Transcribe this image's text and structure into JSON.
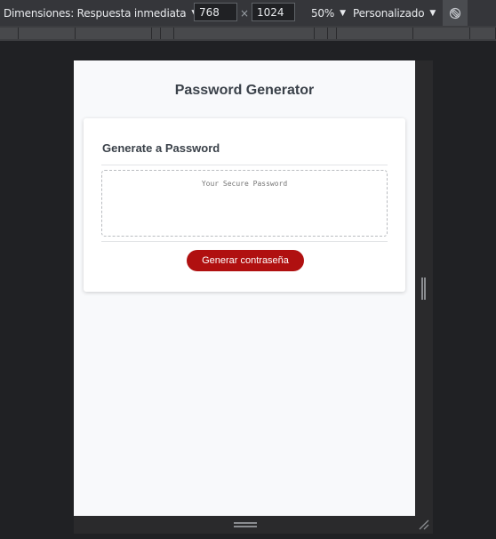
{
  "toolbar": {
    "dimensions_label": "Dimensiones: Respuesta inmediata",
    "width_value": "768",
    "times_symbol": "×",
    "height_value": "1024",
    "zoom_label": "50%",
    "throttle_label": "Personalizado",
    "rotate_icon": "rotate-icon"
  },
  "page": {
    "title": "Password Generator",
    "card": {
      "title": "Generate a Password",
      "password_placeholder": "Your Secure Password",
      "password_value": "",
      "button_label": "Generar contraseña",
      "button_color": "#b01010"
    }
  },
  "colors": {
    "toolbar_bg": "#35363a",
    "devtools_bg": "#202124",
    "page_bg": "#f8f9fb",
    "card_bg": "#ffffff",
    "text_dark": "#3a4149"
  }
}
